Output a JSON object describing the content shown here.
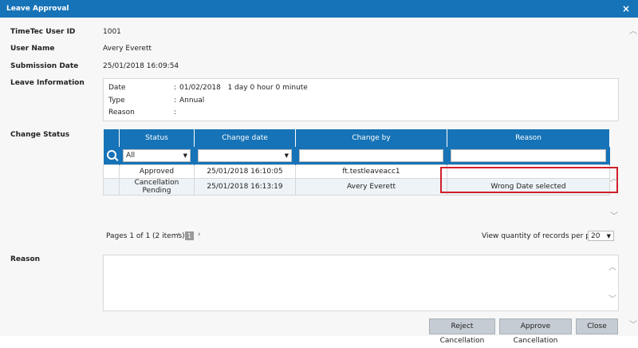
{
  "window": {
    "title": "Leave Approval",
    "close_glyph": "×"
  },
  "fields": {
    "user_id_label": "TimeTec User ID",
    "user_id": "1001",
    "user_name_label": "User Name",
    "user_name": "Avery Everett",
    "submission_date_label": "Submission Date",
    "submission_date": "25/01/2018 16:09:54",
    "leave_info_label": "Leave Information",
    "change_status_label": "Change Status",
    "reason_label": "Reason"
  },
  "leave_info": {
    "rows": [
      {
        "label": "Date",
        "value": "01/02/2018   1 day 0 hour 0 minute"
      },
      {
        "label": "Type",
        "value": "Annual"
      },
      {
        "label": "Reason",
        "value": ""
      }
    ]
  },
  "grid": {
    "columns": [
      "Status",
      "Change date",
      "Change by",
      "Reason"
    ],
    "filter_status": "All",
    "rows": [
      {
        "status": "Approved",
        "change_date": "25/01/2018 16:10:05",
        "change_by": "ft.testleaveacc1",
        "reason": ""
      },
      {
        "status": "Cancellation Pending",
        "change_date": "25/01/2018 16:13:19",
        "change_by": "Avery Everett",
        "reason": "Wrong Date selected"
      }
    ]
  },
  "pager": {
    "summary": "Pages 1 of 1 (2 items)",
    "current_page": "1",
    "per_page_label": "View quantity of records per page",
    "per_page_value": "20"
  },
  "buttons": {
    "reject": "Reject Cancellation",
    "approve": "Approve Cancellation",
    "close": "Close"
  },
  "colors": {
    "accent": "#1673b7",
    "highlight": "#d0202a"
  }
}
